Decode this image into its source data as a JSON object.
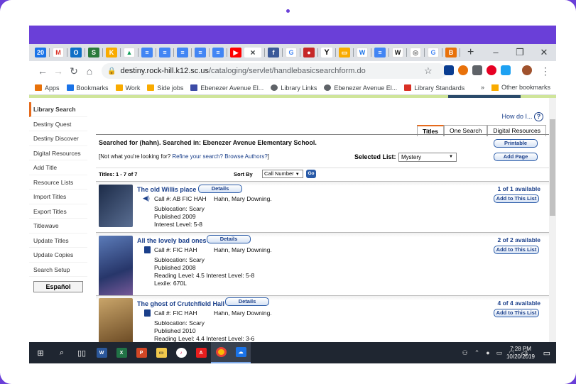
{
  "browser": {
    "address": {
      "domain": "destiny.rock-hill.k12.sc.us",
      "path": "/cataloging/servlet/handlebasicsearchform.do"
    },
    "tab_close_glyph": "×",
    "new_tab_glyph": "+",
    "window_controls": [
      "–",
      "❐",
      "✕"
    ],
    "bookmarks": [
      {
        "label": "Apps",
        "color": "#e8710a"
      },
      {
        "label": "Bookmarks",
        "color": "#1a73e8"
      },
      {
        "label": "Work",
        "color": "#f9ab00"
      },
      {
        "label": "Side jobs",
        "color": "#f9ab00"
      },
      {
        "label": "Ebenezer Avenue El...",
        "color": "#3c4ba6"
      },
      {
        "label": "Library Links",
        "color": "#5f6368"
      },
      {
        "label": "Ebenezer Avenue El...",
        "color": "#5f6368"
      },
      {
        "label": "Library Standards",
        "color": "#d93025"
      }
    ],
    "more_bookmarks": "»",
    "other_bookmarks": "Other bookmarks"
  },
  "sidebar": {
    "items": [
      "Library Search",
      "Destiny Quest",
      "Destiny Discover",
      "Digital Resources",
      "Add Title",
      "Resource Lists",
      "Import Titles",
      "Export Titles",
      "Titlewave",
      "Update Titles",
      "Update Copies",
      "Search Setup"
    ],
    "language_button": "Español"
  },
  "page": {
    "how_do_i": "How do I...",
    "help_glyph": "?",
    "tabs": [
      "Titles",
      "One Search",
      "Digital Resources"
    ],
    "searched_for": "Searched for (hahn). Searched in: Ebenezer Avenue Elementary School.",
    "not_what_prefix": "[Not what you're looking for? ",
    "refine_link": "Refine your search?",
    "browse_link": "Browse Authors?",
    "not_what_suffix": "]",
    "printable_button": "Printable",
    "add_page_button": "Add Page",
    "selected_list_label": "Selected List:",
    "selected_list_value": "Mystery",
    "titles_count": "Titles: 1 - 7 of 7",
    "sort_by_label": "Sort By",
    "sort_by_value": "Call Number",
    "go_button": "Go",
    "details_button": "Details",
    "add_to_list_button": "Add to This List"
  },
  "results": [
    {
      "title": "The old Willis place",
      "call_no": "Call #: AB FIC HAH",
      "author": "Hahn, Mary Downing.",
      "sublocation": "Sublocation: Scary",
      "published": "Published 2009",
      "levels": "Interest Level: 5-8",
      "lexile": "",
      "availability": "1 of 1 available",
      "media": "audio",
      "cover_color": "#2a3f60"
    },
    {
      "title": "All the lovely bad ones",
      "call_no": "Call #: FIC HAH",
      "author": "Hahn, Mary Downing.",
      "sublocation": "Sublocation: Scary",
      "published": "Published 2008",
      "levels": "Reading Level: 4.5  Interest Level: 5-8",
      "lexile": "Lexile: 670L",
      "availability": "2 of 2 available",
      "media": "book",
      "cover_color": "#3a4f8a"
    },
    {
      "title": "The ghost of Crutchfield Hall",
      "call_no": "Call #: FIC HAH",
      "author": "Hahn, Mary Downing.",
      "sublocation": "Sublocation: Scary",
      "published": "Published 2010",
      "levels": "Reading Level: 4.4  Interest Level: 3-6",
      "lexile": "",
      "availability": "4 of 4 available",
      "media": "book",
      "cover_color": "#8a6a3a"
    }
  ],
  "taskbar": {
    "time": "7:28 PM",
    "date": "10/20/2019"
  },
  "colors": {
    "frame_purple": "#6a3fd8",
    "accent_orange": "#e56a1c",
    "link_blue": "#1a3f8a"
  }
}
